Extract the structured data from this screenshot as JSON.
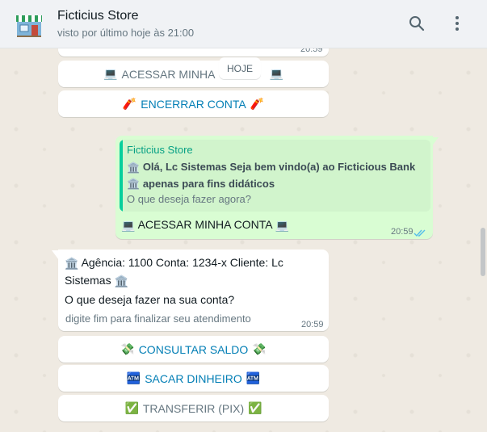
{
  "header": {
    "contact_name": "Ficticius Store",
    "status": "visto por último hoje às 21:00",
    "icons": [
      "store-avatar-icon",
      "search-icon",
      "menu-dots-icon"
    ]
  },
  "day_separator": "HOJE",
  "top_partial_message": {
    "time": "20:59"
  },
  "top_buttons": [
    {
      "emoji": "💻",
      "label": "ACESSAR MINHA",
      "emoji_after": "💻"
    },
    {
      "emoji": "🧨",
      "label": "ENCERRAR CONTA",
      "emoji_after": "🧨"
    }
  ],
  "outgoing": {
    "quote_author": "Ficticius Store",
    "quote_line1": "Olá, Lc Sistemas Seja bem vindo(a) ao Ficticious Bank",
    "quote_line2": "apenas para fins didáticos",
    "quote_sub": "O que deseja fazer agora?",
    "text": "ACESSAR MINHA CONTA",
    "time": "20:59"
  },
  "incoming": {
    "line1": "Agência: 1100 Conta: 1234-x Cliente: Lc",
    "line2": "Sistemas",
    "question": "O que deseja fazer na sua conta?",
    "footer": "digite fim para finalizar seu atendimento",
    "time": "20:59"
  },
  "buttons": [
    {
      "emoji": "💸",
      "label": "CONSULTAR SALDO",
      "emoji_after": "💸"
    },
    {
      "emoji": "🏧",
      "label": "SACAR DINHEIRO",
      "emoji_after": "🏧"
    },
    {
      "emoji": "✅",
      "label": "TRANSFERIR (PIX)",
      "emoji_after": "✅"
    }
  ],
  "colors": {
    "accent": "#027eb5",
    "outgoing_bubble": "#d9fdd3",
    "incoming_bubble": "#ffffff",
    "chat_bg": "#efeae2",
    "read_ticks": "#53bdeb"
  }
}
